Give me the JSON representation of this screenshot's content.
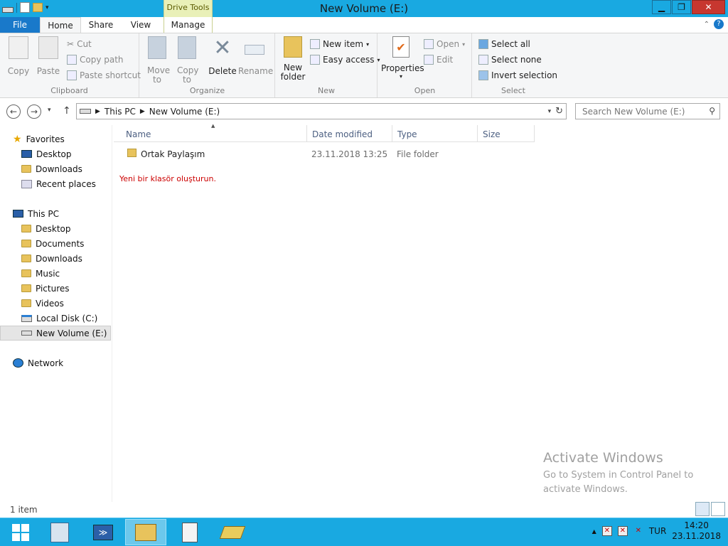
{
  "window": {
    "title": "New Volume (E:)",
    "context_tab": "Drive Tools"
  },
  "tabs": {
    "file": "File",
    "home": "Home",
    "share": "Share",
    "view": "View",
    "manage": "Manage"
  },
  "ribbon": {
    "clipboard": {
      "label": "Clipboard",
      "copy": "Copy",
      "paste": "Paste",
      "cut": "Cut",
      "copy_path": "Copy path",
      "paste_shortcut": "Paste shortcut"
    },
    "organize": {
      "label": "Organize",
      "move_to": "Move to",
      "copy_to": "Copy to",
      "delete": "Delete",
      "rename": "Rename"
    },
    "new": {
      "label": "New",
      "new_folder": "New folder",
      "new_item": "New item",
      "easy_access": "Easy access"
    },
    "open": {
      "label": "Open",
      "properties": "Properties",
      "open": "Open",
      "edit": "Edit"
    },
    "select": {
      "label": "Select",
      "select_all": "Select all",
      "select_none": "Select none",
      "invert_selection": "Invert selection"
    }
  },
  "address": {
    "segments": [
      "This PC",
      "New Volume (E:)"
    ],
    "search_placeholder": "Search New Volume (E:)"
  },
  "nav": {
    "favorites": {
      "label": "Favorites",
      "items": [
        "Desktop",
        "Downloads",
        "Recent places"
      ]
    },
    "this_pc": {
      "label": "This PC",
      "items": [
        "Desktop",
        "Documents",
        "Downloads",
        "Music",
        "Pictures",
        "Videos",
        "Local Disk (C:)",
        "New Volume (E:)"
      ]
    },
    "network": "Network"
  },
  "columns": [
    "Name",
    "Date modified",
    "Type",
    "Size"
  ],
  "files": [
    {
      "name": "Ortak Paylaşım",
      "date": "23.11.2018 13:25",
      "type": "File folder",
      "size": ""
    }
  ],
  "hint": "Yeni bir klasör oluşturun.",
  "watermark": {
    "line1": "Activate Windows",
    "line2": "Go to System in Control Panel to activate Windows."
  },
  "status": "1 item",
  "taskbar": {
    "lang": "TUR",
    "time": "14:20",
    "date": "23.11.2018"
  },
  "colors": {
    "titlebar": "#19a9e1",
    "file_tab": "#1979ca",
    "hint": "#cc0000"
  }
}
